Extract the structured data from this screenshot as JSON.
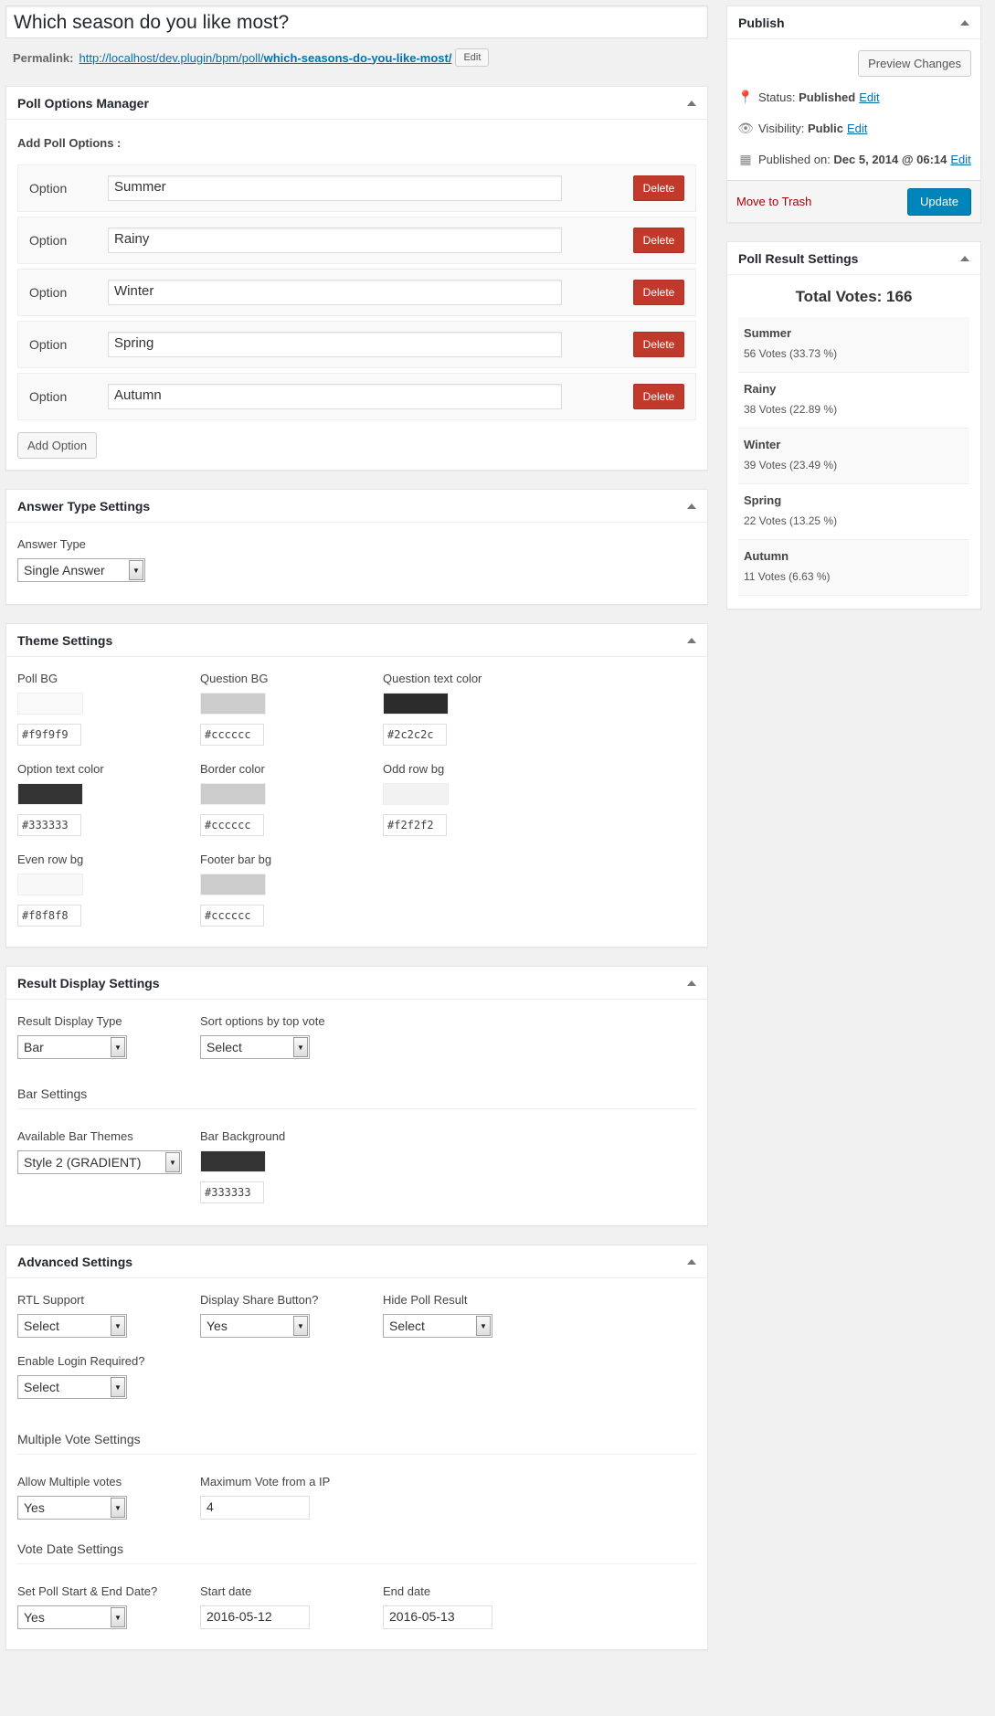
{
  "post": {
    "title": "Which season do you like most?",
    "permalink_label": "Permalink:",
    "permalink_base": "http://localhost/dev.plugin/bpm/poll/",
    "permalink_slug": "which-seasons-do-you-like-most/",
    "edit_label": "Edit"
  },
  "options_manager": {
    "title": "Poll Options Manager",
    "add_label": "Add Poll Options :",
    "option_label": "Option",
    "delete_label": "Delete",
    "options": [
      "Summer",
      "Rainy",
      "Winter",
      "Spring",
      "Autumn"
    ],
    "add_button": "Add Option"
  },
  "answer_type": {
    "title": "Answer Type Settings",
    "label": "Answer Type",
    "value": "Single Answer"
  },
  "theme": {
    "title": "Theme Settings",
    "fields": [
      {
        "label": "Poll BG",
        "value": "#f9f9f9"
      },
      {
        "label": "Question BG",
        "value": "#cccccc"
      },
      {
        "label": "Question text color",
        "value": "#2c2c2c"
      },
      {
        "label": "Option text color",
        "value": "#333333"
      },
      {
        "label": "Border color",
        "value": "#cccccc"
      },
      {
        "label": "Odd row bg",
        "value": "#f2f2f2"
      },
      {
        "label": "Even row bg",
        "value": "#f8f8f8"
      },
      {
        "label": "Footer bar bg",
        "value": "#cccccc"
      }
    ]
  },
  "result_display": {
    "title": "Result Display Settings",
    "type_label": "Result Display Type",
    "type_value": "Bar",
    "sort_label": "Sort options by top vote",
    "sort_value": "Select",
    "bar_heading": "Bar Settings",
    "themes_label": "Available Bar Themes",
    "themes_value": "Style 2 (GRADIENT)",
    "bg_label": "Bar Background",
    "bg_value": "#333333"
  },
  "advanced": {
    "title": "Advanced Settings",
    "rtl_label": "RTL Support",
    "rtl_value": "Select",
    "share_label": "Display Share Button?",
    "share_value": "Yes",
    "hide_label": "Hide Poll Result",
    "hide_value": "Select",
    "login_label": "Enable Login Required?",
    "login_value": "Select",
    "multi_heading": "Multiple Vote Settings",
    "multi_label": "Allow Multiple votes",
    "multi_value": "Yes",
    "maxip_label": "Maximum Vote from a IP",
    "maxip_value": "4",
    "date_heading": "Vote Date Settings",
    "setdate_label": "Set Poll Start & End Date?",
    "setdate_value": "Yes",
    "start_label": "Start date",
    "start_value": "2016-05-12",
    "end_label": "End date",
    "end_value": "2016-05-13"
  },
  "publish": {
    "title": "Publish",
    "preview": "Preview Changes",
    "status_label": "Status:",
    "status_value": "Published",
    "visibility_label": "Visibility:",
    "visibility_value": "Public",
    "published_label": "Published on:",
    "published_value": "Dec 5, 2014 @ 06:14",
    "edit": "Edit",
    "trash": "Move to Trash",
    "update": "Update"
  },
  "results": {
    "title": "Poll Result Settings",
    "total": "Total Votes: 166",
    "items": [
      {
        "name": "Summer",
        "votes": "56 Votes (33.73 %)"
      },
      {
        "name": "Rainy",
        "votes": "38 Votes (22.89 %)"
      },
      {
        "name": "Winter",
        "votes": "39 Votes (23.49 %)"
      },
      {
        "name": "Spring",
        "votes": "22 Votes (13.25 %)"
      },
      {
        "name": "Autumn",
        "votes": "11 Votes (6.63 %)"
      }
    ]
  }
}
